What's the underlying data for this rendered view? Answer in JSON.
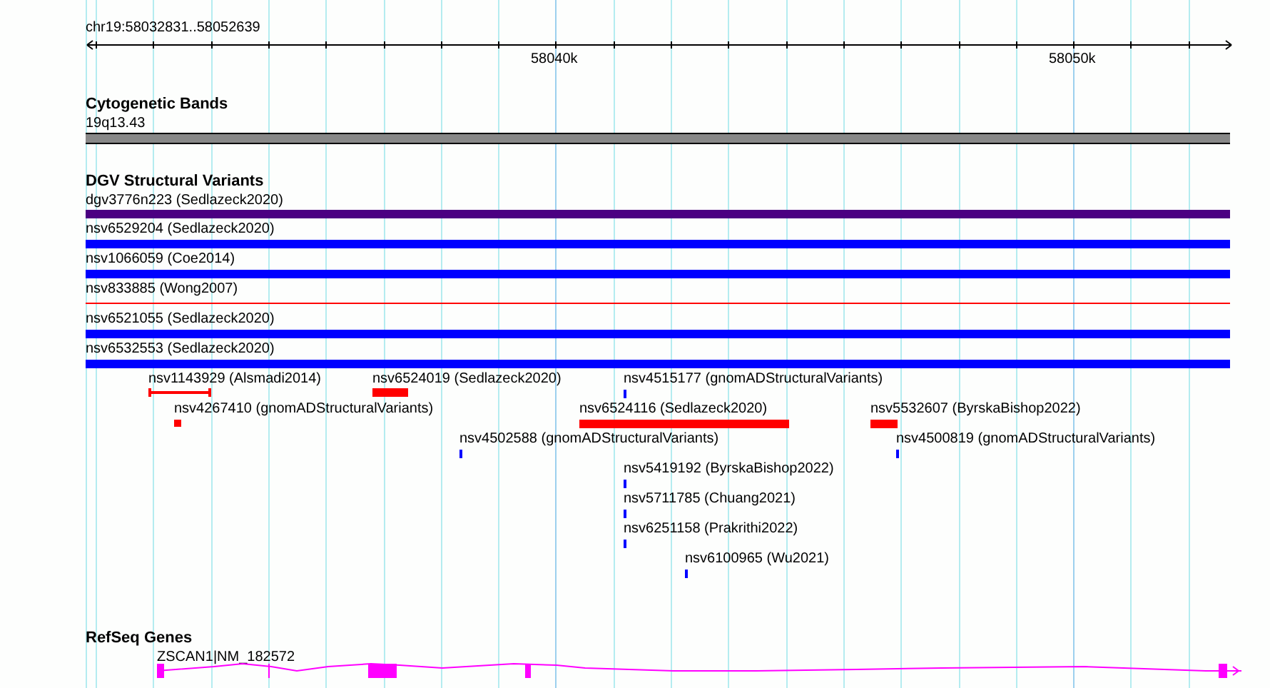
{
  "ruler": {
    "region": "chr19:58032831..58052639",
    "tick_labels": [
      "58040k",
      "58050k"
    ]
  },
  "cytogenetic_bands": {
    "title": "Cytogenetic Bands",
    "band": "19q13.43"
  },
  "dgv_structural_variants": {
    "title": "DGV Structural Variants",
    "features": [
      {
        "label": "dgv3776n223 (Sedlazeck2020)",
        "color": "#4b0082",
        "kind": "bar"
      },
      {
        "label": "nsv6529204 (Sedlazeck2020)",
        "color": "#0000ff",
        "kind": "bar"
      },
      {
        "label": "nsv1066059 (Coe2014)",
        "color": "#0000ff",
        "kind": "bar"
      },
      {
        "label": "nsv833885 (Wong2007)",
        "color": "#ff0000",
        "kind": "line"
      },
      {
        "label": "nsv6521055 (Sedlazeck2020)",
        "color": "#0000ff",
        "kind": "bar"
      },
      {
        "label": "nsv6532553 (Sedlazeck2020)",
        "color": "#0000ff",
        "kind": "bar"
      },
      {
        "label": "nsv1143929 (Alsmadi2014)",
        "color": "#ff0000",
        "kind": "capped"
      },
      {
        "label": "nsv6524019 (Sedlazeck2020)",
        "color": "#ff0000",
        "kind": "bar"
      },
      {
        "label": "nsv4515177 (gnomADStructuralVariants)",
        "color": "#0000ff",
        "kind": "bar"
      },
      {
        "label": "nsv4267410 (gnomADStructuralVariants)",
        "color": "#ff0000",
        "kind": "bar"
      },
      {
        "label": "nsv6524116 (Sedlazeck2020)",
        "color": "#ff0000",
        "kind": "bar"
      },
      {
        "label": "nsv5532607 (ByrskaBishop2022)",
        "color": "#ff0000",
        "kind": "bar"
      },
      {
        "label": "nsv4502588 (gnomADStructuralVariants)",
        "color": "#0000ff",
        "kind": "bar"
      },
      {
        "label": "nsv4500819 (gnomADStructuralVariants)",
        "color": "#0000ff",
        "kind": "bar"
      },
      {
        "label": "nsv5419192 (ByrskaBishop2022)",
        "color": "#0000ff",
        "kind": "bar"
      },
      {
        "label": "nsv5711785 (Chuang2021)",
        "color": "#0000ff",
        "kind": "bar"
      },
      {
        "label": "nsv6251158 (Prakrithi2022)",
        "color": "#0000ff",
        "kind": "bar"
      },
      {
        "label": "nsv6100965 (Wu2021)",
        "color": "#0000ff",
        "kind": "bar"
      }
    ]
  },
  "refseq_genes": {
    "title": "RefSeq Genes",
    "gene": "ZSCAN1|NM_182572"
  }
}
